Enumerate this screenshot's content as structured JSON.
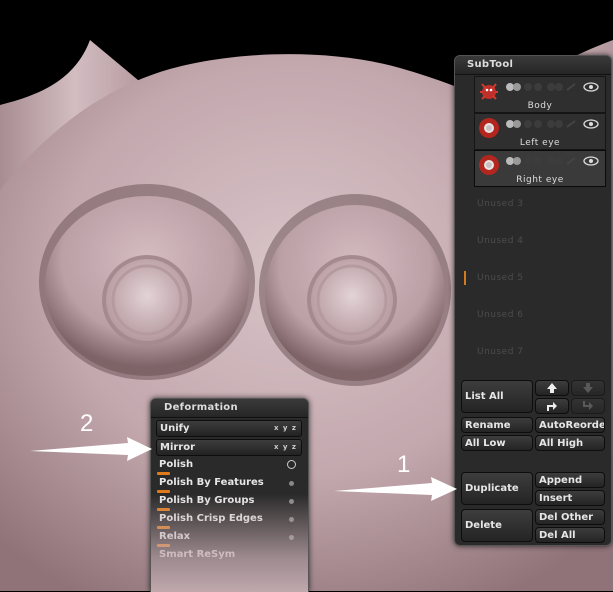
{
  "subtool": {
    "title": "SubTool",
    "items": [
      {
        "name": "Body",
        "state": "used"
      },
      {
        "name": "Left eye",
        "state": "used"
      },
      {
        "name": "Right eye",
        "state": "used selected"
      },
      {
        "name": "Unused 3",
        "state": "unused"
      },
      {
        "name": "Unused 4",
        "state": "unused"
      },
      {
        "name": "Unused 5",
        "state": "unused"
      },
      {
        "name": "Unused 6",
        "state": "unused"
      },
      {
        "name": "Unused 7",
        "state": "unused"
      }
    ],
    "buttons": {
      "list_all": "List All",
      "rename": "Rename",
      "auto_reorder": "AutoReorde",
      "all_low": "All Low",
      "all_high": "All High",
      "duplicate": "Duplicate",
      "append": "Append",
      "insert": "Insert",
      "delete": "Delete",
      "del_other": "Del Other",
      "del_all": "Del All"
    }
  },
  "deformation": {
    "title": "Deformation",
    "items": {
      "unify": "Unify",
      "mirror": "Mirror",
      "polish": "Polish",
      "polish_by_features": "Polish By Features",
      "polish_by_groups": "Polish By Groups",
      "polish_crisp_edges": "Polish Crisp Edges",
      "relax": "Relax",
      "smart_resym": "Smart ReSym"
    },
    "axis_label": "x y z"
  },
  "annotations": {
    "step1": "1",
    "step2": "2"
  },
  "colors": {
    "accent_orange": "#e07b1c",
    "model_skin": "#c3a7ad",
    "panel_bg": "#2a2a2a",
    "eye_red": "#c0302a"
  }
}
